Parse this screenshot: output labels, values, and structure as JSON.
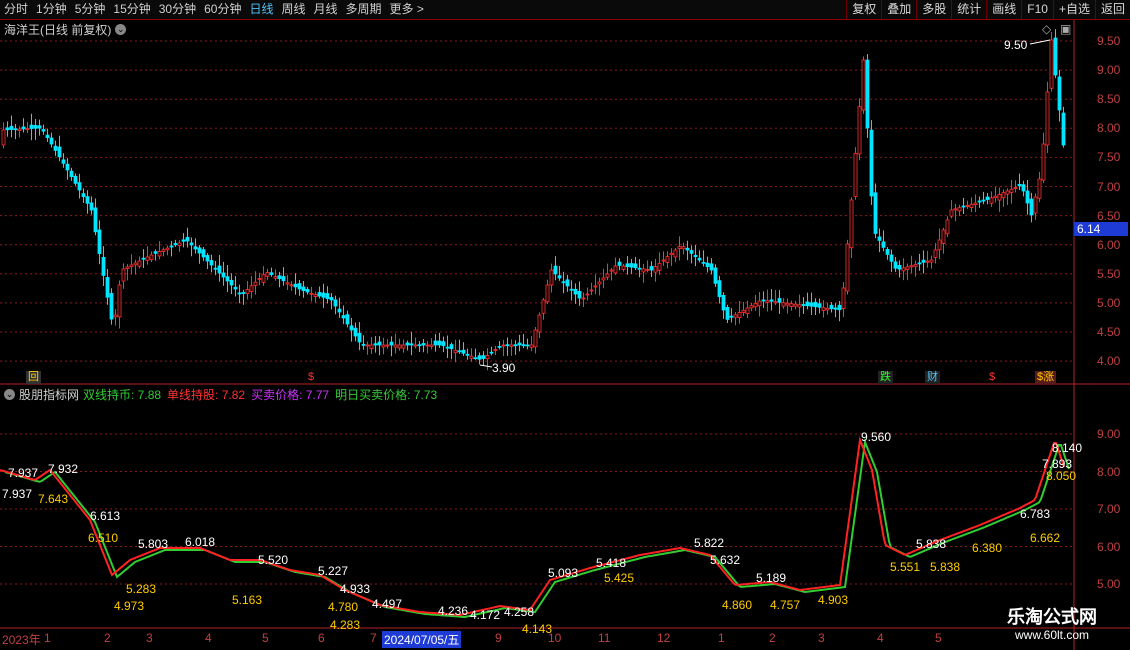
{
  "toolbar": {
    "tabs": [
      "分时",
      "1分钟",
      "5分钟",
      "15分钟",
      "30分钟",
      "60分钟",
      "日线",
      "周线",
      "月线",
      "多周期",
      "更多 >"
    ],
    "active_tab": "日线",
    "tools": [
      "复权",
      "叠加",
      "多股",
      "统计",
      "画线",
      "F10",
      "+自选",
      "返回"
    ]
  },
  "main_panel": {
    "title": "海洋王(日线 前复权)",
    "price_ticks": [
      "9.50",
      "9.00",
      "8.50",
      "8.00",
      "7.50",
      "7.00",
      "6.50",
      "6.00",
      "5.50",
      "5.00",
      "4.50",
      "4.00"
    ],
    "current_price": "6.14",
    "high_label": "9.50",
    "low_label": "3.90",
    "markers": [
      "回",
      "$",
      "跌",
      "财",
      "$",
      "$涨"
    ]
  },
  "indicator_panel": {
    "title": "股朋指标网",
    "readouts": [
      {
        "text": "双线持币: 7.88",
        "color": "#33cc33"
      },
      {
        "text": "单线持股: 7.82",
        "color": "#ff3333"
      },
      {
        "text": "买卖价格: 7.77",
        "color": "#cc33ff"
      },
      {
        "text": "明日买卖价格: 7.73",
        "color": "#33cc33"
      }
    ],
    "ticks": [
      "9.00",
      "8.00",
      "7.00",
      "6.00",
      "5.00"
    ],
    "peak_label": "9.560",
    "price_labels": [
      {
        "t": "7.937",
        "c": "#fff"
      },
      {
        "t": "7.932",
        "c": "#fff"
      },
      {
        "t": "7.937",
        "c": "#fff"
      },
      {
        "t": "7.643",
        "c": "#ffcc00"
      },
      {
        "t": "6.613",
        "c": "#fff"
      },
      {
        "t": "6.510",
        "c": "#ffcc00"
      },
      {
        "t": "5.803",
        "c": "#fff"
      },
      {
        "t": "6.018",
        "c": "#fff"
      },
      {
        "t": "5.520",
        "c": "#fff"
      },
      {
        "t": "5.227",
        "c": "#fff"
      },
      {
        "t": "4.933",
        "c": "#fff"
      },
      {
        "t": "4.973",
        "c": "#ffcc00"
      },
      {
        "t": "5.283",
        "c": "#ffcc00"
      },
      {
        "t": "5.163",
        "c": "#ffcc00"
      },
      {
        "t": "4.780",
        "c": "#ffcc00"
      },
      {
        "t": "4.283",
        "c": "#ffcc00"
      },
      {
        "t": "4.497",
        "c": "#fff"
      },
      {
        "t": "4.236",
        "c": "#fff"
      },
      {
        "t": "4.172",
        "c": "#fff"
      },
      {
        "t": "4.258",
        "c": "#fff"
      },
      {
        "t": "4.143",
        "c": "#ffcc00"
      },
      {
        "t": "5.093",
        "c": "#fff"
      },
      {
        "t": "5.418",
        "c": "#fff"
      },
      {
        "t": "5.425",
        "c": "#ffcc00"
      },
      {
        "t": "5.822",
        "c": "#fff"
      },
      {
        "t": "5.632",
        "c": "#fff"
      },
      {
        "t": "5.189",
        "c": "#fff"
      },
      {
        "t": "4.860",
        "c": "#ffcc00"
      },
      {
        "t": "4.757",
        "c": "#ffcc00"
      },
      {
        "t": "4.903",
        "c": "#ffcc00"
      },
      {
        "t": "5.838",
        "c": "#fff"
      },
      {
        "t": "5.551",
        "c": "#ffcc00"
      },
      {
        "t": "5.838",
        "c": "#ffcc00"
      },
      {
        "t": "6.380",
        "c": "#ffcc00"
      },
      {
        "t": "6.783",
        "c": "#fff"
      },
      {
        "t": "6.662",
        "c": "#ffcc00"
      },
      {
        "t": "8.140",
        "c": "#fff"
      },
      {
        "t": "7.893",
        "c": "#fff"
      },
      {
        "t": "8.050",
        "c": "#ffcc00"
      }
    ]
  },
  "x_axis": {
    "labels": [
      "2023年",
      "1",
      "2",
      "3",
      "4",
      "5",
      "6",
      "7",
      "2024/07/05/五",
      "9",
      "10",
      "11",
      "12",
      "1",
      "2",
      "3",
      "4",
      "5"
    ]
  },
  "watermark": {
    "title": "乐淘公式网",
    "url": "www.60lt.com"
  },
  "colors": {
    "up": "#ff3333",
    "down": "#00e5ff",
    "grid": "#8b1a1a",
    "axis": "#c04040"
  }
}
